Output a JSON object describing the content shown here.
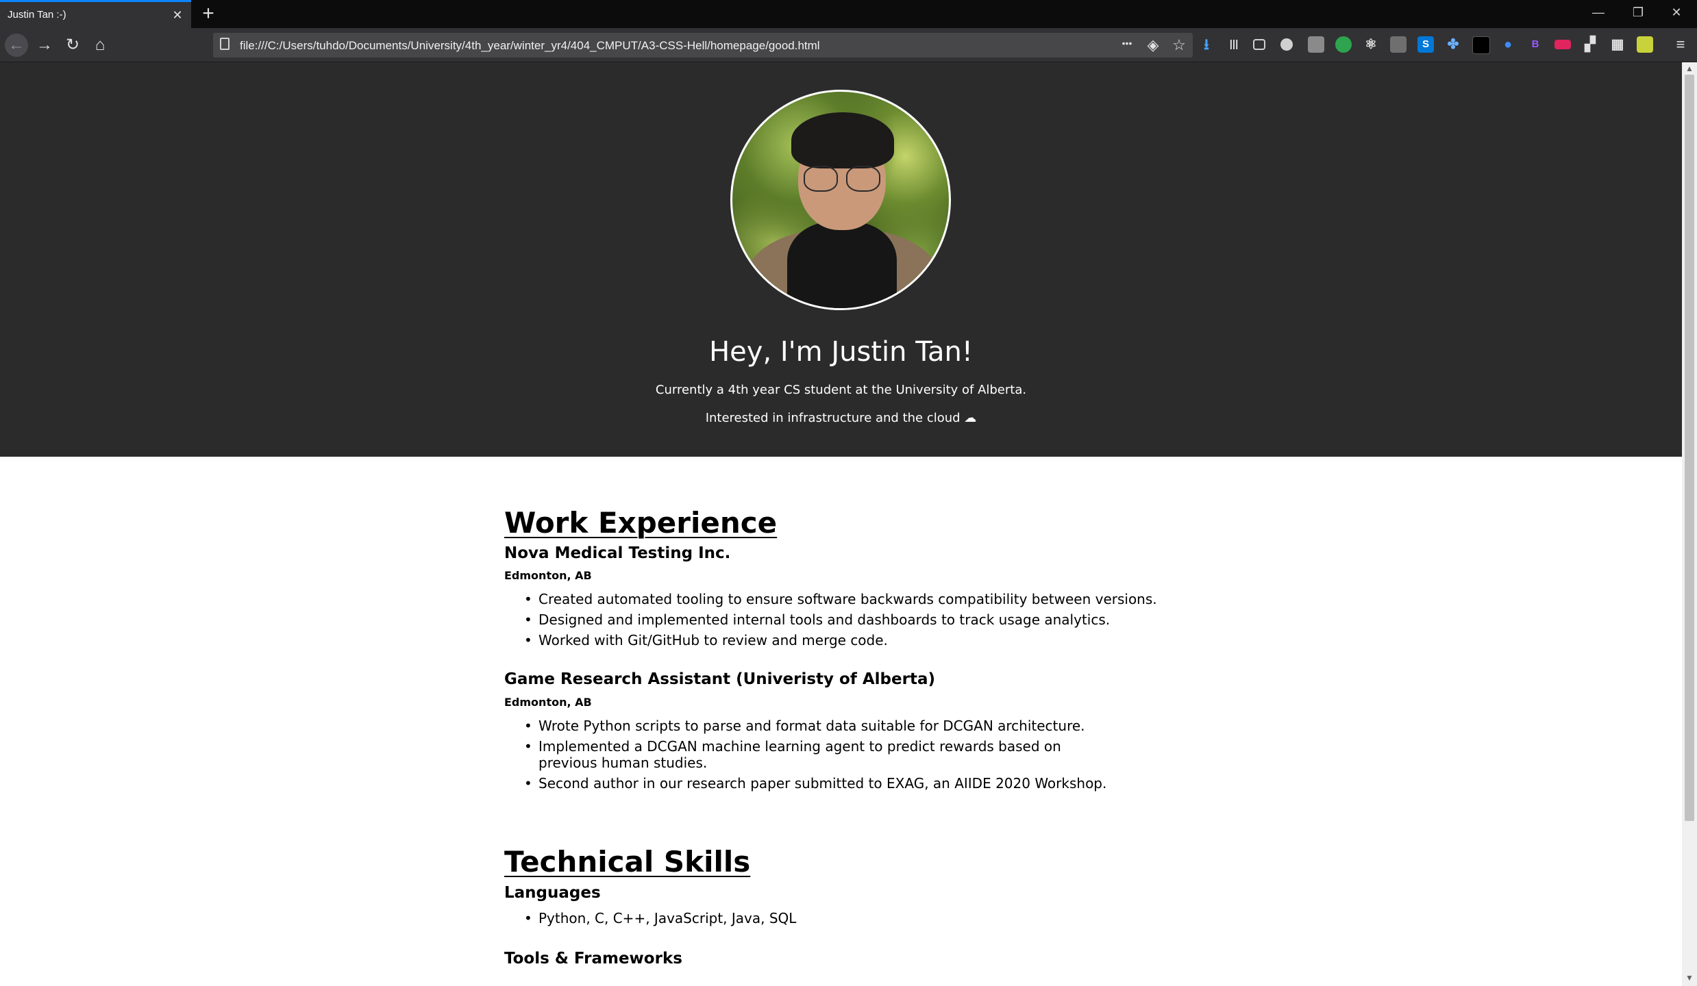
{
  "tab": {
    "title": "Justin Tan :-)",
    "close": "✕",
    "new_tab": "+"
  },
  "window_controls": {
    "minimize": "—",
    "restore": "❐",
    "close": "✕"
  },
  "navbar": {
    "back": "←",
    "forward": "→",
    "reload": "↻",
    "home": "⌂",
    "url": "file:///C:/Users/tuhdo/Documents/University/4th_year/winter_yr4/404_CMPUT/A3-CSS-Hell/homepage/good.html",
    "more": "•••",
    "pocket": "◈",
    "bookmark": "☆"
  },
  "toolbar_icons": [
    "download-icon",
    "library-icon",
    "sidebar-icon",
    "account-icon",
    "extension-icon",
    "extension-icon",
    "react-devtools-icon",
    "privacy-icon",
    "skype-icon",
    "extension-icon",
    "extension-icon",
    "drop-icon",
    "extension-icon",
    "extension-icon",
    "extension-icon",
    "grid-icon",
    "extension-icon",
    "menu-icon"
  ],
  "hero": {
    "title": "Hey, I'm Justin Tan!",
    "subtitle1": "Currently a 4th year CS student at the University of Alberta.",
    "subtitle2": "Interested in infrastructure and the cloud ☁"
  },
  "work": {
    "heading": "Work Experience",
    "jobs": [
      {
        "company": "Nova Medical Testing Inc.",
        "location": "Edmonton, AB",
        "bullets": [
          "Created automated tooling to ensure software backwards compatibility between versions.",
          "Designed and implemented internal tools and dashboards to track usage analytics.",
          "Worked with Git/GitHub to review and merge code."
        ]
      },
      {
        "company": "Game Research Assistant (Univeristy of Alberta)",
        "location": "Edmonton, AB",
        "bullets": [
          "Wrote Python scripts to parse and format data suitable for DCGAN architecture.",
          "Implemented a DCGAN machine learning agent to predict rewards based on previous human studies.",
          "Second author in our research paper submitted to EXAG, an AIIDE 2020 Workshop."
        ]
      }
    ]
  },
  "skills": {
    "heading": "Technical Skills",
    "languages_heading": "Languages",
    "languages": "Python, C, C++, JavaScript, Java, SQL",
    "tools_heading": "Tools & Frameworks"
  }
}
